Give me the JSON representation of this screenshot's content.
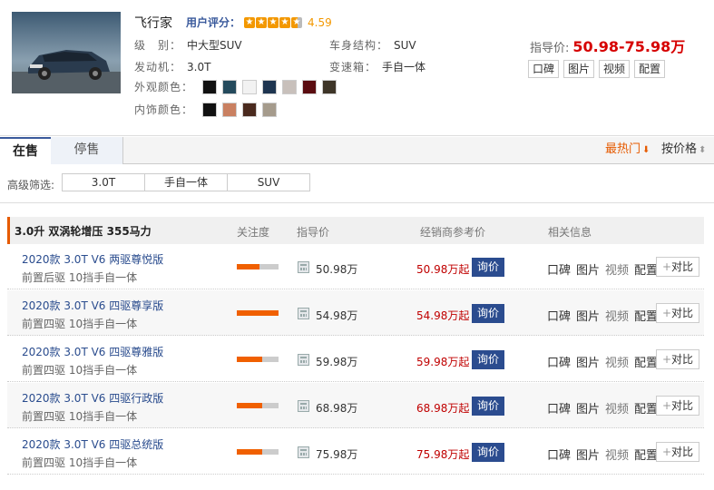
{
  "car": {
    "name": "飞行家",
    "rating_label": "用户评分：",
    "rating_score": "4.59",
    "rating_value": 4.59,
    "rating_max": 5,
    "specs": {
      "level_label": "级　别：",
      "level_value": "中大型SUV",
      "engine_label": "发动机：",
      "engine_value": "3.0T",
      "body_label": "车身结构：",
      "body_value": "SUV",
      "gearbox_label": "变速箱：",
      "gearbox_value": "手自一体"
    },
    "exterior_label": "外观颜色：",
    "exterior_colors": [
      "#111111",
      "#244a5c",
      "#f2f2f2",
      "#1e3550",
      "#c8c0bb",
      "#5a0c10",
      "#3e3528"
    ],
    "interior_label": "内饰颜色：",
    "interior_colors": [
      "#111111",
      "#c98061",
      "#4a2a1e",
      "#a59b8c"
    ],
    "price_label": "指导价:",
    "price_value": "50.98-75.98万",
    "buttons": [
      "口碑",
      "图片",
      "视频",
      "配置"
    ]
  },
  "tabs": {
    "active": "在售",
    "inactive": "停售",
    "sort_hot": "最热门",
    "sort_price": "按价格"
  },
  "filter": {
    "label": "高级筛选:",
    "options": [
      "3.0T",
      "手自一体",
      "SUV"
    ]
  },
  "group": {
    "title": "3.0升 双涡轮增压 355马力",
    "columns": {
      "heat": "关注度",
      "msrp": "指导价",
      "dealer": "经销商参考价",
      "info": "相关信息"
    }
  },
  "rows": [
    {
      "name": "2020款 3.0T V6 两驱尊悦版",
      "sub": "前置后驱 10挡手自一体",
      "heat": 0.55,
      "msrp": "50.98万",
      "dealer": "50.98万起"
    },
    {
      "name": "2020款 3.0T V6 四驱尊享版",
      "sub": "前置四驱 10挡手自一体",
      "heat": 1.0,
      "msrp": "54.98万",
      "dealer": "54.98万起"
    },
    {
      "name": "2020款 3.0T V6 四驱尊雅版",
      "sub": "前置四驱 10挡手自一体",
      "heat": 0.6,
      "msrp": "59.98万",
      "dealer": "59.98万起"
    },
    {
      "name": "2020款 3.0T V6 四驱行政版",
      "sub": "前置四驱 10挡手自一体",
      "heat": 0.6,
      "msrp": "68.98万",
      "dealer": "68.98万起"
    },
    {
      "name": "2020款 3.0T V6 四驱总统版",
      "sub": "前置四驱 10挡手自一体",
      "heat": 0.6,
      "msrp": "75.98万",
      "dealer": "75.98万起"
    }
  ],
  "row_actions": {
    "ask": "询价",
    "links": [
      "口碑",
      "图片",
      "视频",
      "配置"
    ],
    "compare": "对比"
  }
}
